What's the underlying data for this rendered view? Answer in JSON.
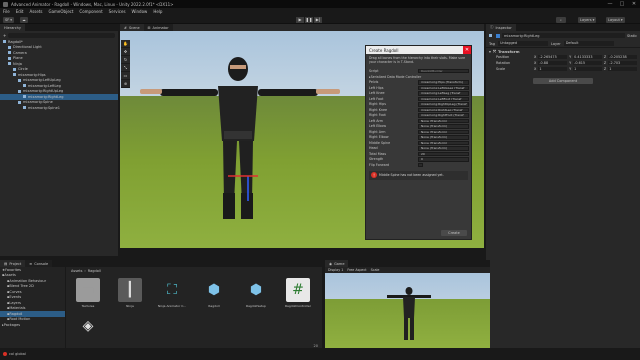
{
  "window": {
    "title": "Advanced Animator - Ragdoll - Windows, Mac, Linux - Unity 2022.2.0f1* <DX11>",
    "controls": [
      "—",
      "□",
      "✕"
    ]
  },
  "menu": [
    "File",
    "Edit",
    "Assets",
    "GameObject",
    "Component",
    "Services",
    "Window",
    "Help"
  ],
  "toolbar": {
    "account": "SF",
    "layers": "Layers",
    "layout": "Layout"
  },
  "hierarchy": {
    "tab": "Hierarchy",
    "items": [
      {
        "label": "Ragdoll*",
        "indent": 0,
        "selected": false
      },
      {
        "label": "Directional Light",
        "indent": 1,
        "selected": false
      },
      {
        "label": "Camera",
        "indent": 1,
        "selected": false
      },
      {
        "label": "Plane",
        "indent": 1,
        "selected": false
      },
      {
        "label": "Ninja",
        "indent": 1,
        "selected": false
      },
      {
        "label": "Circle",
        "indent": 2,
        "selected": false
      },
      {
        "label": "mixamorig:Hips",
        "indent": 2,
        "selected": false
      },
      {
        "label": "mixamorig:LeftUpLeg",
        "indent": 3,
        "selected": false
      },
      {
        "label": "mixamorig:LeftLeg",
        "indent": 4,
        "selected": false
      },
      {
        "label": "mixamorig:RightUpLeg",
        "indent": 3,
        "selected": false
      },
      {
        "label": "mixamorig:RightLeg",
        "indent": 4,
        "selected": true
      },
      {
        "label": "mixamorig:Spine",
        "indent": 3,
        "selected": false
      },
      {
        "label": "mixamorig:Spine1",
        "indent": 4,
        "selected": false
      }
    ]
  },
  "scene": {
    "tabs": [
      "Scene",
      "Animator"
    ]
  },
  "dialog": {
    "title": "Create Ragdoll",
    "info": "Drag all bones from the hierarchy into their slots. Make sure your character is in T-Stand.",
    "script_label": "Script",
    "script_value": "RagdollBuilder",
    "section": "Serialized Data Mode Controller",
    "rows": [
      {
        "label": "Pelvis",
        "value": "mixamorig:Hips (Transform)"
      },
      {
        "label": "Left Hips",
        "value": "mixamorig:LeftUpLeg (Transf"
      },
      {
        "label": "Left Knee",
        "value": "mixamorig:LeftLeg (Transf"
      },
      {
        "label": "Left Foot",
        "value": "mixamorig:LeftFoot (Transf"
      },
      {
        "label": "Right Hips",
        "value": "mixamorig:RightUpLeg (Transf"
      },
      {
        "label": "Right Knee",
        "value": "mixamorig:RightLeg (Transf"
      },
      {
        "label": "Right Foot",
        "value": "mixamorig:RightFoot (Transf"
      },
      {
        "label": "Left Arm",
        "value": "None (Transform)"
      },
      {
        "label": "Left Elbow",
        "value": "None (Transform)"
      },
      {
        "label": "Right Arm",
        "value": "None (Transform)"
      },
      {
        "label": "Right Elbow",
        "value": "None (Transform)"
      },
      {
        "label": "Middle Spine",
        "value": "None (Transform)"
      },
      {
        "label": "Head",
        "value": "None (Transform)"
      },
      {
        "label": "Total Mass",
        "value": "20"
      },
      {
        "label": "Strength",
        "value": "0"
      },
      {
        "label": "Flip Forward",
        "value": ""
      }
    ],
    "error": "Middle Spine has not been assigned yet.",
    "create_button": "Create"
  },
  "inspector": {
    "tab": "Inspector",
    "object_name": "mixamorig:RightLeg",
    "static_label": "Static",
    "tag_label": "Tag",
    "tag_value": "Untagged",
    "layer_label": "Layer",
    "layer_value": "Default",
    "transform_title": "Transform",
    "position": {
      "label": "Position",
      "x": "-2.265475",
      "y": "0.4133333",
      "z": "-0.205238"
    },
    "rotation": {
      "label": "Rotation",
      "x": "-0.88",
      "y": "-0.615",
      "z": "-2.703"
    },
    "scale": {
      "label": "Scale",
      "x": "1",
      "y": "1",
      "z": "1"
    },
    "add_component": "Add Component"
  },
  "project": {
    "tabs": [
      "Project",
      "Console"
    ],
    "favorites": "Favorites",
    "tree": [
      {
        "label": "Assets",
        "indent": 0,
        "selected": false
      },
      {
        "label": "Animation Behaviour",
        "indent": 1,
        "selected": false
      },
      {
        "label": "Blend Tree 2D",
        "indent": 1,
        "selected": false
      },
      {
        "label": "Curves",
        "indent": 1,
        "selected": false
      },
      {
        "label": "Events",
        "indent": 1,
        "selected": false
      },
      {
        "label": "Layers",
        "indent": 1,
        "selected": false
      },
      {
        "label": "Materials",
        "indent": 1,
        "selected": false
      },
      {
        "label": "Ragdoll",
        "indent": 1,
        "selected": true
      },
      {
        "label": "Root Motion",
        "indent": 1,
        "selected": false
      }
    ],
    "packages": "Packages",
    "breadcrumb": [
      "Assets",
      "Ragdoll"
    ],
    "assets": [
      {
        "name": "Textures",
        "icon": "folder-icon"
      },
      {
        "name": "Ninja",
        "icon": "model-icon"
      },
      {
        "name": "Ninja Animator C...",
        "icon": "animator-icon"
      },
      {
        "name": "Ragdoll",
        "icon": "prefab-icon"
      },
      {
        "name": "RagdollSetup",
        "icon": "prefab-icon"
      },
      {
        "name": "RagdollController",
        "icon": "script-icon"
      },
      {
        "name": "",
        "icon": "unity-scene-icon"
      }
    ],
    "asset_count": "20"
  },
  "game": {
    "tab": "Game",
    "display": "Display 1",
    "aspect": "Free Aspect",
    "scale_label": "Scale"
  },
  "status": {
    "text": "col global"
  },
  "colors": {
    "accent": "#2c5d87",
    "error": "#d93025",
    "window_chrome": "#191919",
    "panel": "#282828"
  }
}
